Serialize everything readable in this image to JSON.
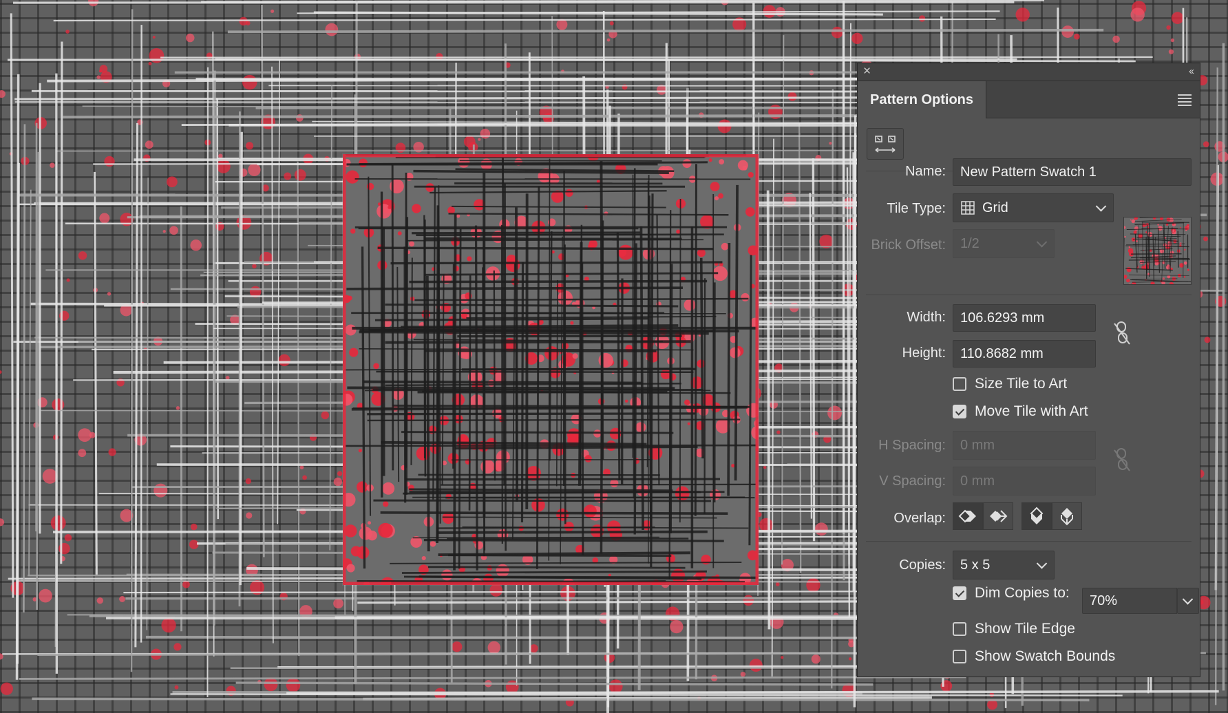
{
  "panel": {
    "tab_title": "Pattern Options",
    "close_glyph": "×",
    "collapse_glyph": "‹‹"
  },
  "form": {
    "name_label": "Name:",
    "name_value": "New Pattern Swatch 1",
    "tile_type_label": "Tile Type:",
    "tile_type_value": "Grid",
    "brick_offset_label": "Brick Offset:",
    "brick_offset_value": "1/2",
    "width_label": "Width:",
    "width_value": "106.6293 mm",
    "height_label": "Height:",
    "height_value": "110.8682 mm",
    "size_tile_label": "Size Tile to Art",
    "size_tile_checked": false,
    "move_tile_label": "Move Tile with Art",
    "move_tile_checked": true,
    "h_spacing_label": "H Spacing:",
    "h_spacing_value": "0 mm",
    "v_spacing_label": "V Spacing:",
    "v_spacing_value": "0 mm",
    "overlap_label": "Overlap:",
    "copies_label": "Copies:",
    "copies_value": "5 x 5",
    "dim_copies_label": "Dim Copies to:",
    "dim_copies_checked": true,
    "dim_copies_value": "70%",
    "show_tile_edge_label": "Show Tile Edge",
    "show_tile_edge_checked": false,
    "show_swatch_bounds_label": "Show Swatch Bounds",
    "show_swatch_bounds_checked": false
  },
  "icons": [
    "close-icon",
    "collapse-icon",
    "panel-menu-icon",
    "pattern-tile-tool-icon",
    "grid-icon",
    "chevron-down-icon",
    "link-icon",
    "overlap-icon"
  ],
  "colors": {
    "accent_red": "#e8283c",
    "pink": "#f0566a",
    "panel_bg": "#535353",
    "canvas_gray": "#606060"
  }
}
